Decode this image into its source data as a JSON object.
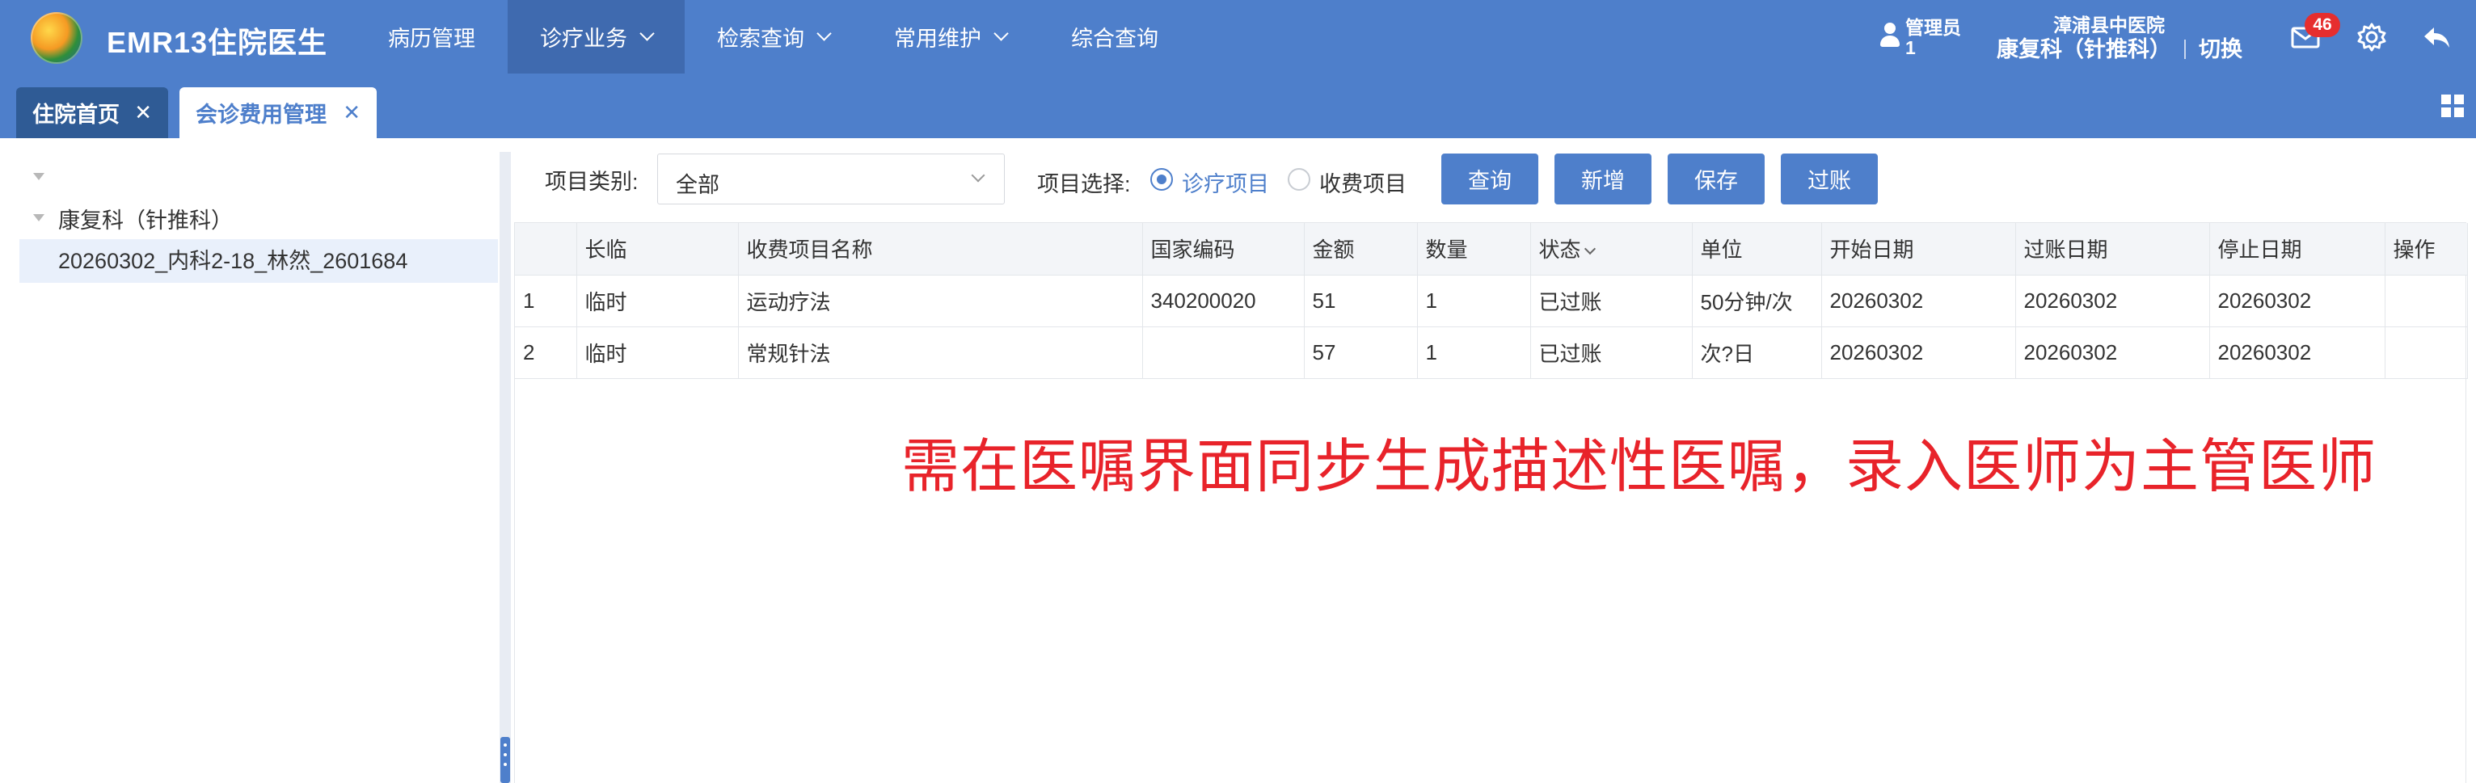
{
  "header": {
    "app_title": "EMR13住院医生",
    "nav": [
      {
        "label": "病历管理",
        "has_menu": false,
        "active": false
      },
      {
        "label": "诊疗业务",
        "has_menu": true,
        "active": true
      },
      {
        "label": "检索查询",
        "has_menu": true,
        "active": false
      },
      {
        "label": "常用维护",
        "has_menu": true,
        "active": false
      },
      {
        "label": "综合查询",
        "has_menu": false,
        "active": false
      }
    ],
    "user_role": "管理员",
    "user_id": "1",
    "hospital": "漳浦县中医院",
    "department": "康复科（针推科）",
    "switch_label": "切换",
    "message_count": "46",
    "icons": {
      "user": "user-icon",
      "mail": "mail-icon",
      "settings": "gear-icon",
      "back": "back-arrow-icon"
    }
  },
  "tabs": [
    {
      "label": "住院首页",
      "active": false
    },
    {
      "label": "会诊费用管理",
      "active": true
    }
  ],
  "tree": {
    "root_label": "",
    "department_label": "康复科（针推科）",
    "patient_label": "20260302_内科2-18_林然_2601684"
  },
  "toolbar": {
    "category_label": "项目类别:",
    "category_value": "全部",
    "item_select_label": "项目选择:",
    "radio_options": [
      "诊疗项目",
      "收费项目"
    ],
    "selected_option": "诊疗项目",
    "buttons": [
      "查询",
      "新增",
      "保存",
      "过账"
    ]
  },
  "table": {
    "columns": [
      "",
      "长临",
      "收费项目名称",
      "国家编码",
      "金额",
      "数量",
      "状态",
      "单位",
      "开始日期",
      "过账日期",
      "停止日期",
      "操作"
    ],
    "rows": [
      [
        "1",
        "临时",
        "运动疗法",
        "340200020",
        "51",
        "1",
        "已过账",
        "50分钟/次",
        "20260302",
        "20260302",
        "20260302",
        ""
      ],
      [
        "2",
        "临时",
        "常规针法",
        "",
        "57",
        "1",
        "已过账",
        "次?日",
        "20260302",
        "20260302",
        "20260302",
        ""
      ]
    ]
  },
  "annotation": "需在医嘱界面同步生成描述性医嘱，录入医师为主管医师",
  "colors": {
    "header_bg": "#4e7fcb",
    "active_nav_bg": "#3f6aaf",
    "home_tab_bg": "#2f5b95",
    "accent": "#4e7fcb",
    "badge": "#e62e2e",
    "annotation": "#e8232a"
  }
}
